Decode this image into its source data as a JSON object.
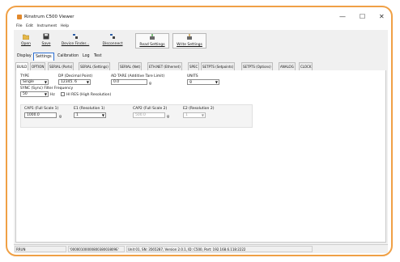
{
  "window": {
    "title": "Rinstrum C500 Viewer",
    "minimize": "—",
    "maximize": "☐",
    "close": "✕"
  },
  "menu": [
    "File",
    "Edit",
    "Instrument",
    "Help"
  ],
  "toolbar": {
    "open": "Open",
    "save": "Save",
    "device_finder": "Device Finder...",
    "disconnect": "Disconnect",
    "read_settings": "Read Settings",
    "write_settings": "Write Settings"
  },
  "tabs": [
    "Display",
    "Settings",
    "Calibration",
    "Log",
    "Test"
  ],
  "subtabs": [
    "BUILD",
    "OPTION",
    "SERIAL (Ports)",
    "SERIAL (Settings)",
    "SERIAL (Net)",
    "ETH.NET (Ethernet)",
    "SPEC",
    "SETPTS (Setpoints)",
    "SETPTS (Options)",
    "ANALOG",
    "CLOCK"
  ],
  "build": {
    "type_label": "TYPE",
    "type_value": "Single",
    "dp_label": "DP (Decimal Point)",
    "dp_value": "12345. 6",
    "ad_tare_label": "AD TARE (Additive Tare Limit)",
    "ad_tare_value": "0.0",
    "ad_tare_unit": "g",
    "units_label": "UNITS",
    "units_value": "g",
    "sync_label": "SYNC (Sync) Filter Frequency",
    "sync_value": "50",
    "sync_unit": "Hz",
    "hires_label": "HI RES (High Resolution)",
    "cap1_label": "CAP1 (Full Scale 1)",
    "cap1_value": "1000.0",
    "cap1_unit": "g",
    "e1_label": "E1 (Resolution 1)",
    "e1_value": "1",
    "cap2_label": "CAP2 (Full Scale 2)",
    "cap2_value": "500.0",
    "cap2_unit": "g",
    "e2_label": "E2 (Resolution 2)",
    "e2_value": "1"
  },
  "status": {
    "left": "RRUN",
    "serial": "'0000010000080038003809E'",
    "info": "Unit 01, SN: 3565287, Version 2.0.1, ID: C500, Port: 192.168.6.118:2222"
  },
  "colors": {
    "frame_border": "#f0a045",
    "active_tab_border": "#2d6fd1",
    "app_icon": "#e2892c"
  }
}
